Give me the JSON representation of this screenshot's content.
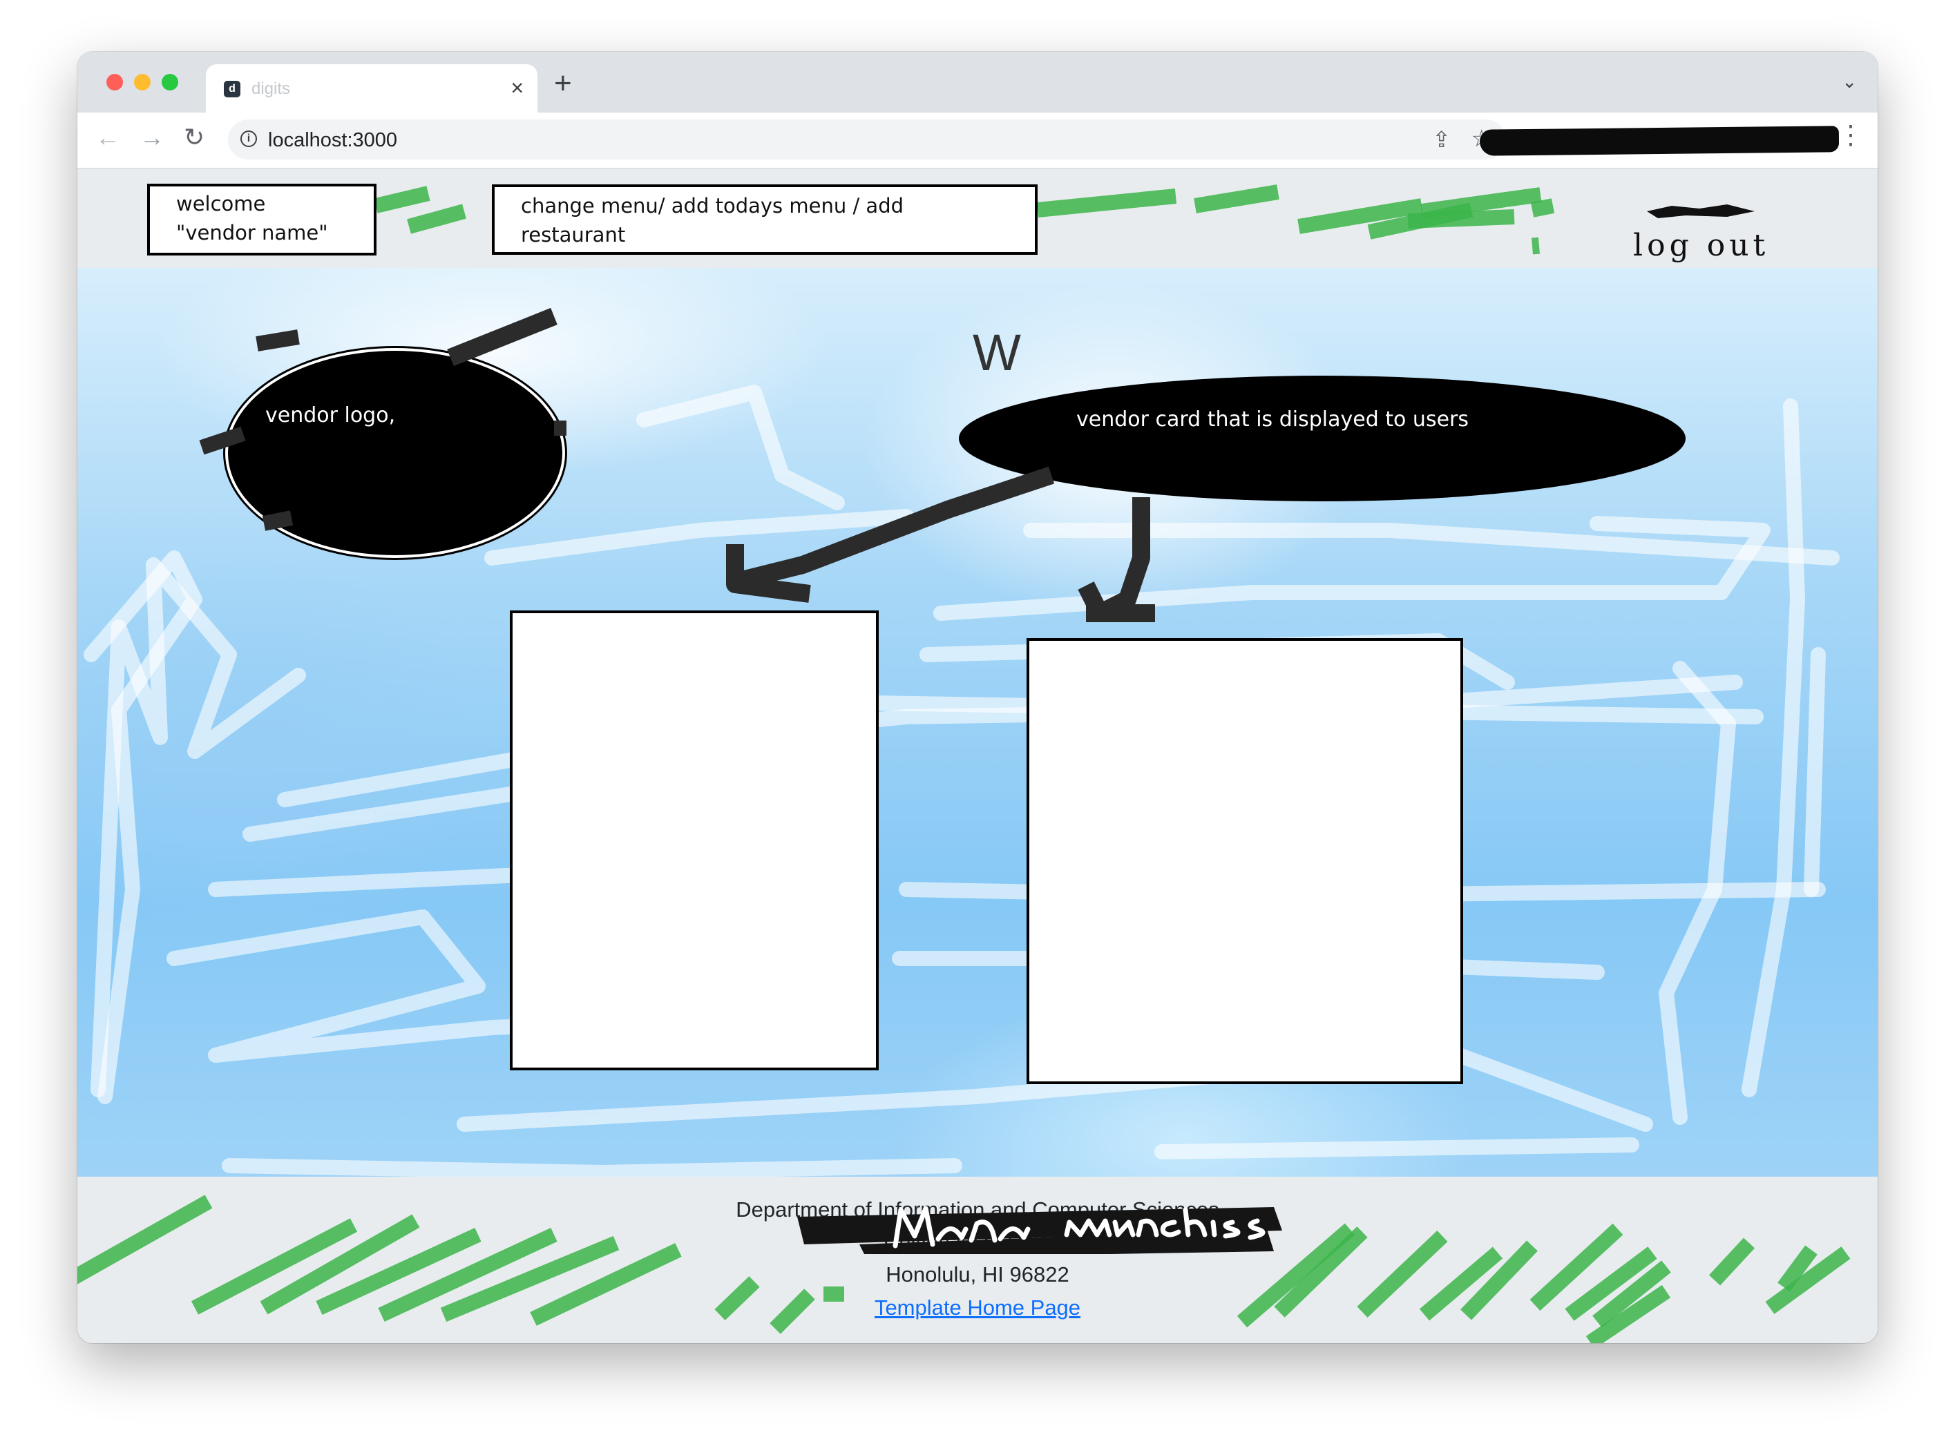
{
  "browser": {
    "tab_title": "digits",
    "tab_favicon": "d",
    "close_glyph": "×",
    "new_tab_glyph": "+",
    "tab_menu_glyph": "⌄",
    "url": "localhost:3000",
    "back_glyph": "←",
    "forward_glyph": "→",
    "reload_glyph": "↻",
    "info_glyph": "i",
    "share_glyph": "⇪",
    "bookmark_glyph": "☆",
    "menu_glyph": "⋮"
  },
  "navbar": {
    "welcome_note": "welcome \"vendor name\"",
    "menu_note": "change menu/ add todays menu / add restaurant",
    "logout": "log out"
  },
  "hero": {
    "heading": "W",
    "logo_note": "vendor logo,",
    "card_note": "vendor card that is displayed to users"
  },
  "footer": {
    "line1": "Department of Information and Computer Sciences",
    "line2": "University of Hawaii",
    "line3": "Honolulu, HI 96822",
    "link": "Template Home Page",
    "signature": "Manoa munchies"
  },
  "colors": {
    "highlighter_green": "#3cb54a",
    "hero_blue": "#86c8f6",
    "footer_link": "#0d6efd"
  }
}
